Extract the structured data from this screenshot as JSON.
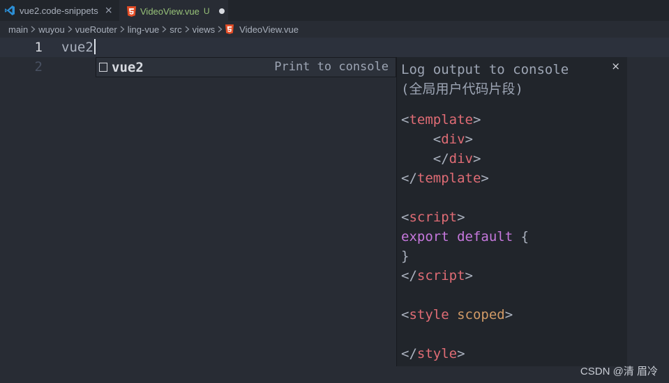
{
  "tabs": [
    {
      "label": "vue2.code-snippets",
      "icon": "vscode-icon",
      "close": "×"
    },
    {
      "label": "VideoView.vue",
      "icon": "html5-icon",
      "status": "U"
    }
  ],
  "breadcrumb": [
    "main",
    "wuyou",
    "vueRouter",
    "ling-vue",
    "src",
    "views",
    "VideoView.vue"
  ],
  "editor": {
    "line_numbers": [
      "1",
      "2"
    ],
    "line1_text": "vue2"
  },
  "suggest": {
    "label": "vue2",
    "detail": "Print to console"
  },
  "details": {
    "close": "×",
    "title": "Log output to console",
    "subtitle": "(全局用户代码片段)",
    "snippet": [
      [
        {
          "t": "<",
          "c": "punc"
        },
        {
          "t": "template",
          "c": "tag"
        },
        {
          "t": ">",
          "c": "punc"
        }
      ],
      [
        {
          "t": "    <",
          "c": "punc"
        },
        {
          "t": "div",
          "c": "tag"
        },
        {
          "t": ">",
          "c": "punc"
        }
      ],
      [
        {
          "t": "    </",
          "c": "punc"
        },
        {
          "t": "div",
          "c": "tag"
        },
        {
          "t": ">",
          "c": "punc"
        }
      ],
      [
        {
          "t": "</",
          "c": "punc"
        },
        {
          "t": "template",
          "c": "tag"
        },
        {
          "t": ">",
          "c": "punc"
        }
      ],
      [],
      [
        {
          "t": "<",
          "c": "punc"
        },
        {
          "t": "script",
          "c": "tag"
        },
        {
          "t": ">",
          "c": "punc"
        }
      ],
      [
        {
          "t": "export",
          "c": "kw"
        },
        {
          "t": " ",
          "c": "punc"
        },
        {
          "t": "default",
          "c": "kw"
        },
        {
          "t": " {",
          "c": "punc"
        }
      ],
      [
        {
          "t": "}",
          "c": "punc"
        }
      ],
      [
        {
          "t": "</",
          "c": "punc"
        },
        {
          "t": "script",
          "c": "tag"
        },
        {
          "t": ">",
          "c": "punc"
        }
      ],
      [],
      [
        {
          "t": "<",
          "c": "punc"
        },
        {
          "t": "style",
          "c": "tag"
        },
        {
          "t": " ",
          "c": "punc"
        },
        {
          "t": "scoped",
          "c": "attr"
        },
        {
          "t": ">",
          "c": "punc"
        }
      ],
      [],
      [
        {
          "t": "</",
          "c": "punc"
        },
        {
          "t": "style",
          "c": "tag"
        },
        {
          "t": ">",
          "c": "punc"
        }
      ]
    ]
  },
  "watermark": "CSDN @清 眉冷",
  "colors": {
    "editor_bg": "#282c34",
    "tabbar_bg": "#21252b",
    "active_tab_text": "#98c379",
    "tag": "#e06c75",
    "keyword": "#c678dd",
    "attribute": "#d19a66",
    "html5_icon": "#e44d26",
    "vscode_icon": "#2c8fd6"
  }
}
